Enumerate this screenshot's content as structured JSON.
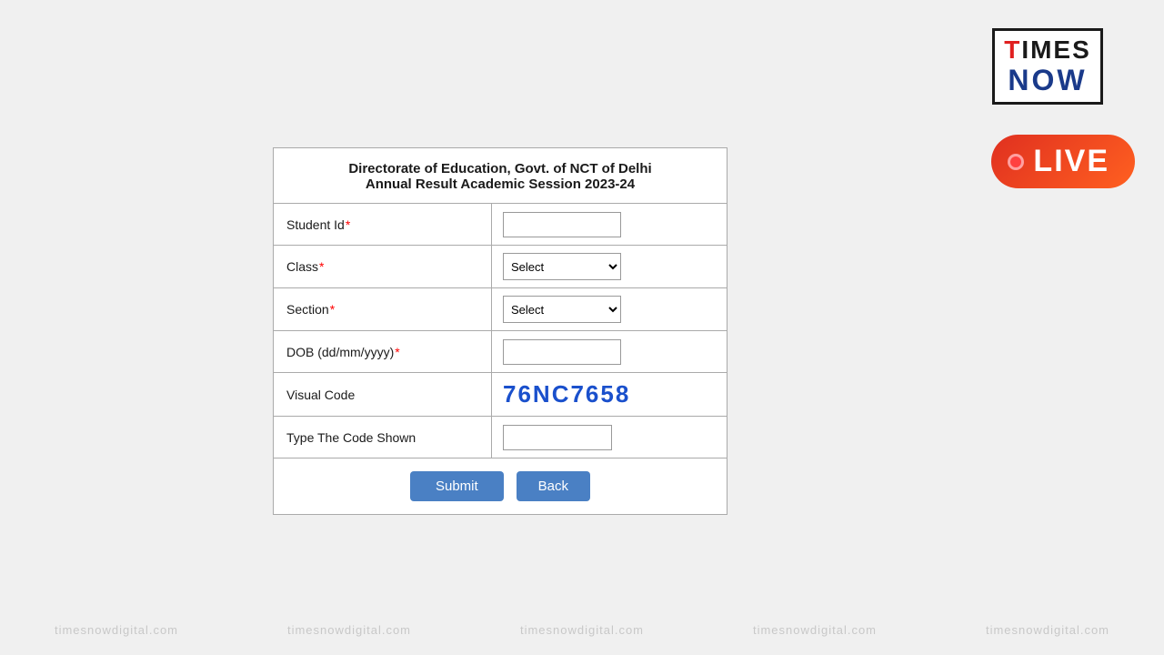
{
  "logo": {
    "times": "TIMES",
    "now": "NOW"
  },
  "live_badge": {
    "label": "LIVE"
  },
  "form": {
    "title_line1": "Directorate of Education, Govt. of NCT of Delhi",
    "title_line2": "Annual Result Academic Session 2023-24",
    "fields": {
      "student_id_label": "Student Id",
      "class_label": "Class",
      "section_label": "Section",
      "dob_label": "DOB (dd/mm/yyyy)",
      "visual_code_label": "Visual Code",
      "visual_code_value": "76NC7658",
      "type_code_label": "Type The Code Shown"
    },
    "select_default": "Select",
    "submit_label": "Submit",
    "back_label": "Back"
  },
  "watermark": {
    "items": [
      "timesnowdigital.com",
      "timesnowdigital.com",
      "timesnowdigital.com",
      "timesnowdigital.com",
      "timesnowdigital.com"
    ]
  }
}
